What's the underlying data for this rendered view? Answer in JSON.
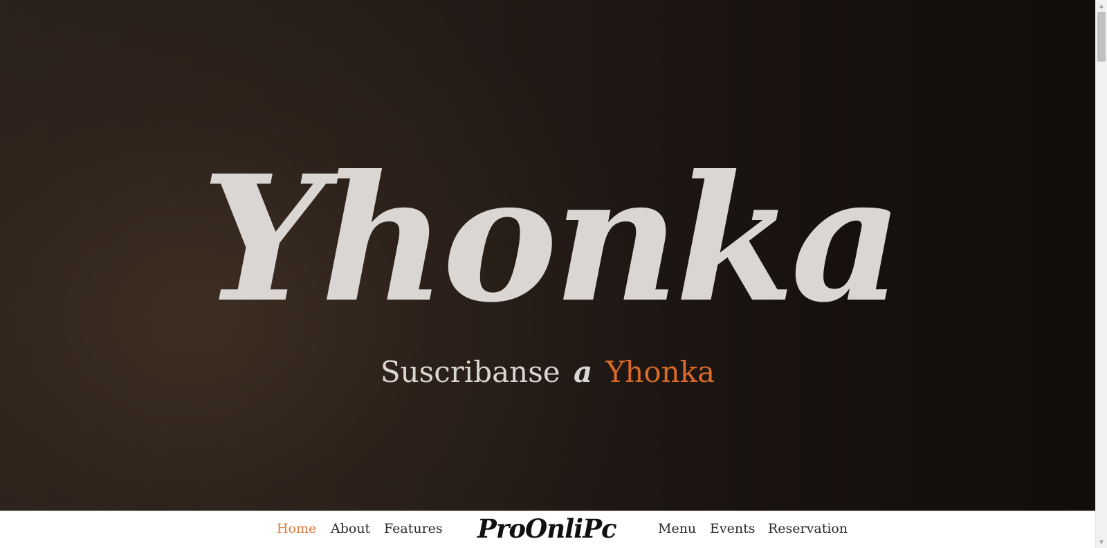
{
  "hero": {
    "title": "Yhonka",
    "subtitle": {
      "text": "Suscribanse",
      "connector": "a",
      "brand": "Yhonka"
    }
  },
  "navbar": {
    "left_links": [
      {
        "label": "Home",
        "active": true
      },
      {
        "label": "About",
        "active": false
      },
      {
        "label": "Features",
        "active": false
      }
    ],
    "logo": "ProOnliPc",
    "right_links": [
      {
        "label": "Menu",
        "active": false
      },
      {
        "label": "Events",
        "active": false
      },
      {
        "label": "Reservation",
        "active": false
      }
    ]
  },
  "scrollbar": {
    "up_icon": "triangle-up-icon",
    "down_icon": "triangle-down-icon"
  },
  "colors": {
    "accent": "#d96a2a",
    "nav_active": "#e07a3e",
    "hero_text": "#d9d6d4",
    "hero_background": "#1a1411",
    "navbar_background": "#ffffff"
  }
}
